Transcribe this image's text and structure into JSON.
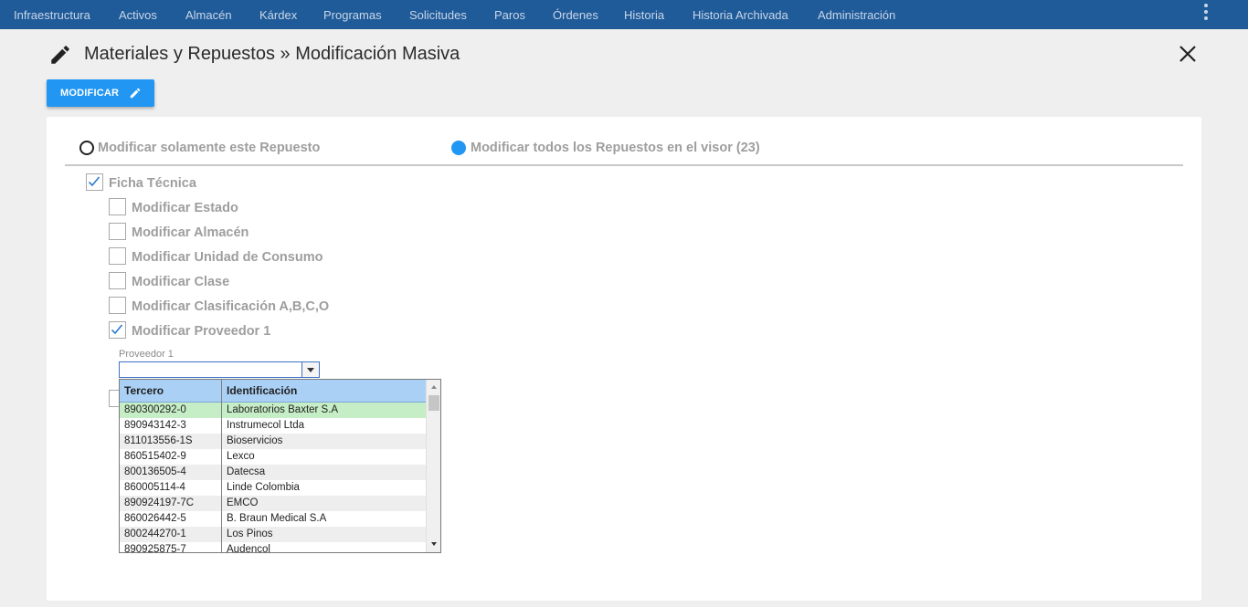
{
  "nav": {
    "items": [
      "Infraestructura",
      "Activos",
      "Almacén",
      "Kárdex",
      "Programas",
      "Solicitudes",
      "Paros",
      "Órdenes",
      "Historia",
      "Historia Archivada",
      "Administración"
    ]
  },
  "header": {
    "title": "Materiales y Repuestos » Modificación Masiva"
  },
  "toolbar": {
    "modify_label": "MODIFICAR"
  },
  "scope": {
    "option_single": "Modificar solamente este Repuesto",
    "option_all": "Modificar todos los Repuestos en el visor (23)",
    "selected": "all"
  },
  "form": {
    "section_label": "Ficha Técnica",
    "section_checked": true,
    "options": [
      {
        "label": "Modificar Estado",
        "checked": false
      },
      {
        "label": "Modificar Almacén",
        "checked": false
      },
      {
        "label": "Modificar Unidad de Consumo",
        "checked": false
      },
      {
        "label": "Modificar Clase",
        "checked": false
      },
      {
        "label": "Modificar Clasificación A,B,C,O",
        "checked": false
      },
      {
        "label": "Modificar Proveedor 1",
        "checked": true
      }
    ],
    "provider_label": "Proveedor 1",
    "provider_value": ""
  },
  "dropdown": {
    "columns": [
      "Tercero",
      "Identificación"
    ],
    "rows": [
      [
        "890300292-0",
        "Laboratorios Baxter S.A"
      ],
      [
        "890943142-3",
        "Instrumecol Ltda"
      ],
      [
        "811013556-1S",
        "Bioservicios"
      ],
      [
        "860515402-9",
        "Lexco"
      ],
      [
        "800136505-4",
        "Datecsa"
      ],
      [
        "860005114-4",
        "Linde Colombia"
      ],
      [
        "890924197-7C",
        "EMCO"
      ],
      [
        "860026442-5",
        "B. Braun Medical S.A"
      ],
      [
        "800244270-1",
        "Los Pinos"
      ],
      [
        "890925875-7",
        "Audencol"
      ]
    ],
    "highlighted_index": 0
  },
  "colors": {
    "nav_bg": "#1f5b99",
    "accent": "#2196f3",
    "row_highlight": "#c6eec6",
    "row_alt": "#eeeeee",
    "header_bg": "#aad0f5"
  }
}
